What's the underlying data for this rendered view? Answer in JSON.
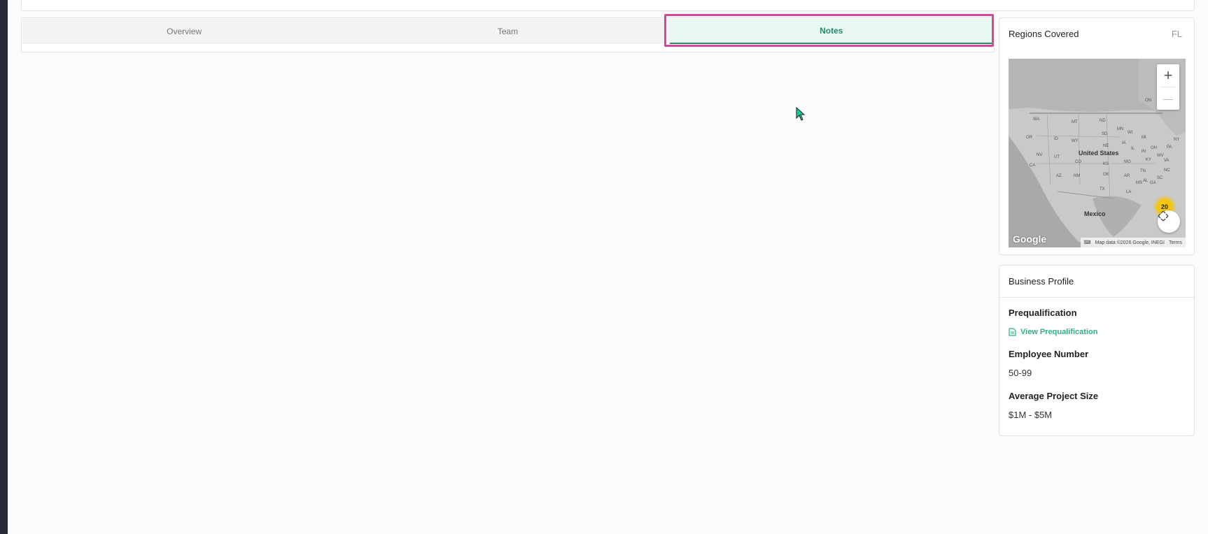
{
  "tabs": [
    {
      "label": "Overview",
      "active": false
    },
    {
      "label": "Team",
      "active": false
    },
    {
      "label": "Notes",
      "active": true
    }
  ],
  "regions": {
    "title": "Regions Covered",
    "code": "FL",
    "map": {
      "country_label": "United States",
      "mexico_label": "Mexico",
      "cluster_count": "20",
      "zoom_in": "+",
      "zoom_out": "—",
      "google_logo": "Google",
      "attribution": "Map data ©2026 Google, INEGI",
      "terms": "Terms",
      "state_labels": [
        "WA",
        "MT",
        "ND",
        "MN",
        "WI",
        "MI",
        "ON",
        "OR",
        "ID",
        "SD",
        "WY",
        "NE",
        "IA",
        "IL",
        "IN",
        "OH",
        "NY",
        "PA",
        "NV",
        "UT",
        "CO",
        "KS",
        "MO",
        "KY",
        "WV",
        "VA",
        "CA",
        "AZ",
        "NM",
        "OK",
        "AR",
        "TN",
        "NC",
        "SC",
        "TX",
        "MS",
        "AL",
        "GA",
        "LA"
      ]
    }
  },
  "profile": {
    "title": "Business Profile",
    "prequal_label": "Prequalification",
    "prequal_link": "View Prequalification",
    "employee_label": "Employee Number",
    "employee_value": "50-99",
    "project_label": "Average Project Size",
    "project_value": "$1M - $5M"
  },
  "colors": {
    "accent": "#2fae84",
    "active_tab_bg": "#e6f8f1",
    "highlight": "#d4479a",
    "cluster": "#f3c60e"
  }
}
